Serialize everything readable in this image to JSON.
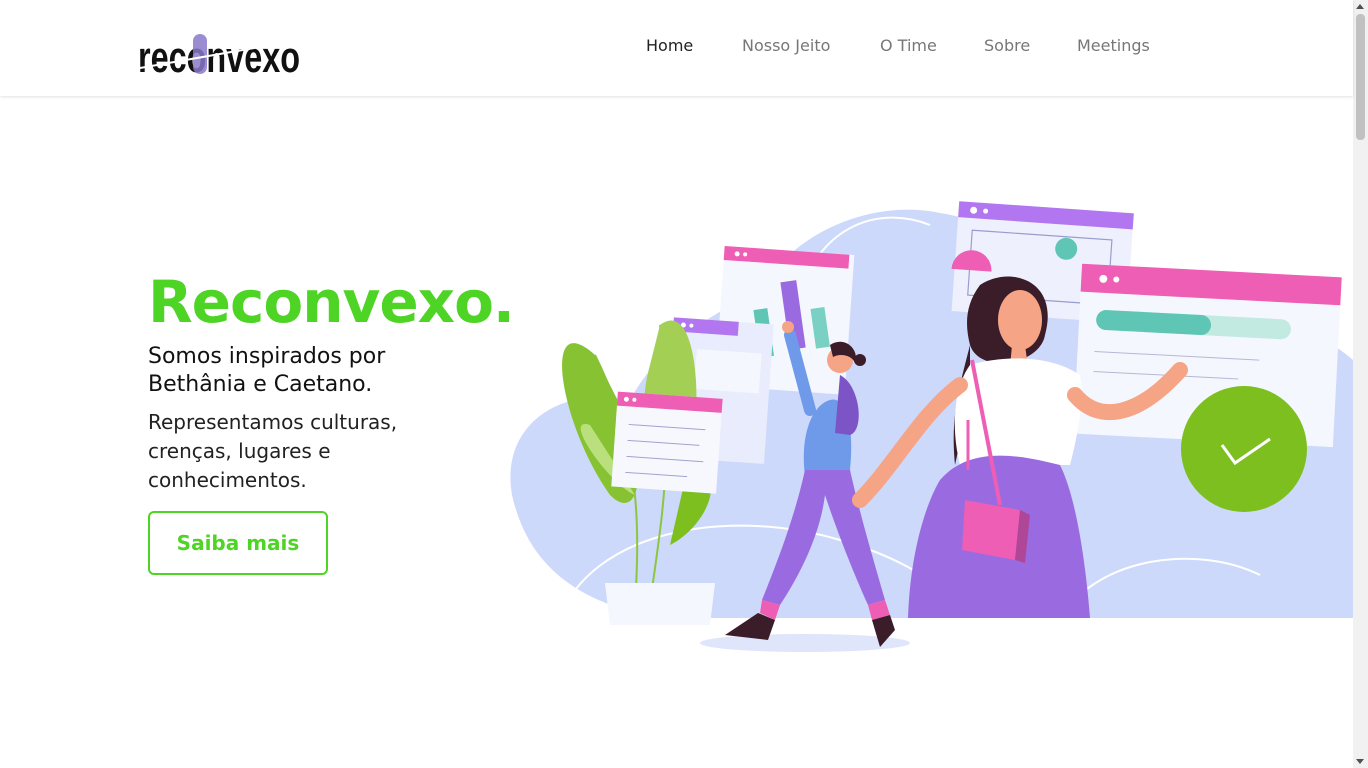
{
  "header": {
    "logo": {
      "text": "reconvexo",
      "highlight_letter": "o"
    },
    "nav": [
      {
        "label": "Home",
        "active": true
      },
      {
        "label": "Nosso Jeito",
        "active": false
      },
      {
        "label": "O Time",
        "active": false
      },
      {
        "label": "Sobre",
        "active": false
      },
      {
        "label": "Meetings",
        "active": false
      }
    ]
  },
  "hero": {
    "title": "Reconvexo.",
    "subtitle": "Somos inspirados por Bethânia e Caetano.",
    "description": "Representamos culturas, crenças, lugares e conhecimentos.",
    "cta_label": "Saiba mais"
  },
  "illustration": {
    "icon": "checkmark-icon"
  },
  "colors": {
    "accent_green": "#4ed425",
    "purple": "#9a6be0",
    "pink": "#ee5eb5",
    "blob_blue": "#cdd9fb",
    "teal": "#5fc5b5"
  }
}
